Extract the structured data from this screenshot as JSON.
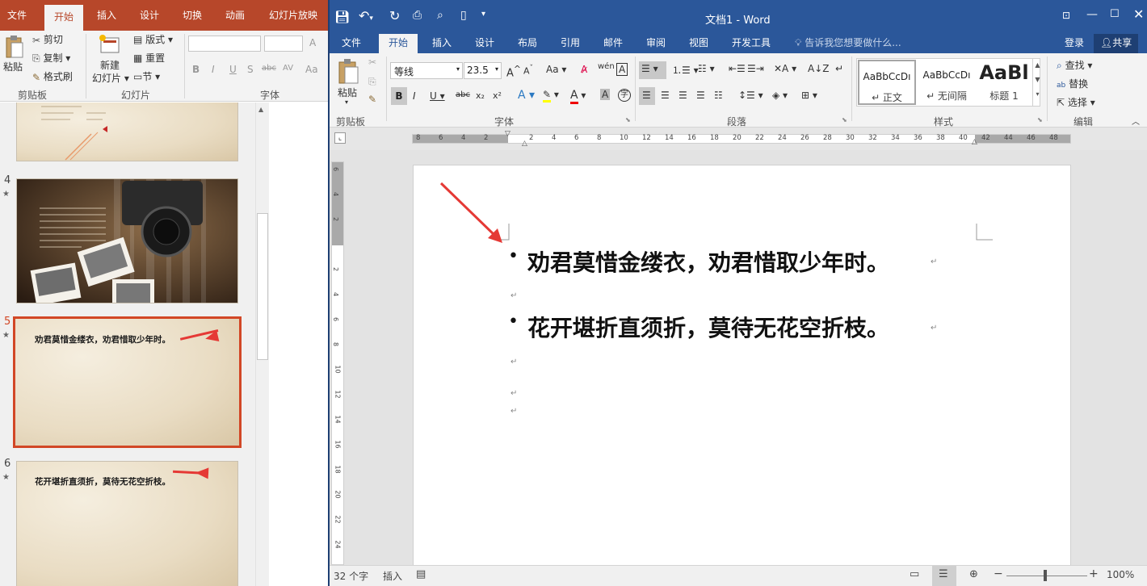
{
  "ppt": {
    "tabs": [
      "文件",
      "开始",
      "插入",
      "设计",
      "切换",
      "动画",
      "幻灯片放映"
    ],
    "ribbon": {
      "paste": "粘贴",
      "cut": "剪切",
      "copy": "复制",
      "format_painter": "格式刷",
      "new_slide": "新建",
      "new_slide2": "幻灯片",
      "layout": "版式",
      "reset": "重置",
      "section": "节",
      "groups": [
        "剪贴板",
        "幻灯片",
        "字体"
      ],
      "font_buttons": [
        "B",
        "I",
        "U",
        "S",
        "abc",
        "AV",
        "Aa"
      ]
    },
    "slides": [
      {
        "num": "4",
        "star": "★"
      },
      {
        "num": "5",
        "star": "★",
        "text": "劝君莫惜金缕衣，劝君惜取少年时。"
      },
      {
        "num": "6",
        "star": "★",
        "text": "花开堪折直须折，莫待无花空折枝。"
      }
    ]
  },
  "word": {
    "title": "文档1 - Word",
    "tabs": [
      "文件",
      "开始",
      "插入",
      "设计",
      "布局",
      "引用",
      "邮件",
      "审阅",
      "视图",
      "开发工具"
    ],
    "tell_me": "告诉我您想要做什么...",
    "login": "登录",
    "share": "共享",
    "ribbon": {
      "paste": "粘贴",
      "font_name": "等线",
      "font_size": "23.5",
      "groups": [
        "剪贴板",
        "字体",
        "段落",
        "样式",
        "编辑"
      ],
      "styles": [
        {
          "preview": "AaBbCcDı",
          "name": "↵ 正文"
        },
        {
          "preview": "AaBbCcDı",
          "name": "↵ 无间隔"
        },
        {
          "preview": "AaBl",
          "name": "标题 1"
        }
      ],
      "find": "查找",
      "replace": "替换",
      "select": "选择"
    },
    "ruler_ticks": [
      "8",
      "6",
      "4",
      "2",
      "",
      "2",
      "4",
      "6",
      "8",
      "10",
      "12",
      "14",
      "16",
      "18",
      "20",
      "22",
      "24",
      "26",
      "28",
      "30",
      "32",
      "34",
      "36",
      "38",
      "40",
      "42",
      "44",
      "46",
      "48"
    ],
    "vruler_ticks": [
      "6",
      "4",
      "2",
      "",
      "2",
      "4",
      "6",
      "8",
      "10",
      "12",
      "14",
      "16",
      "18",
      "20",
      "22",
      "24"
    ],
    "doc": {
      "line1": "劝君莫惜金缕衣，劝君惜取少年时。",
      "line2": "花开堪折直须折，莫待无花空折枝。",
      "para_mark": "↵",
      "bullet": "•"
    },
    "status": {
      "words": "32 个字",
      "mode": "插入",
      "zoom": "100%"
    }
  },
  "colors": {
    "ppt_accent": "#b7472a",
    "word_accent": "#2b579a",
    "arrow": "#e53935",
    "selected_slide": "#d24726"
  }
}
